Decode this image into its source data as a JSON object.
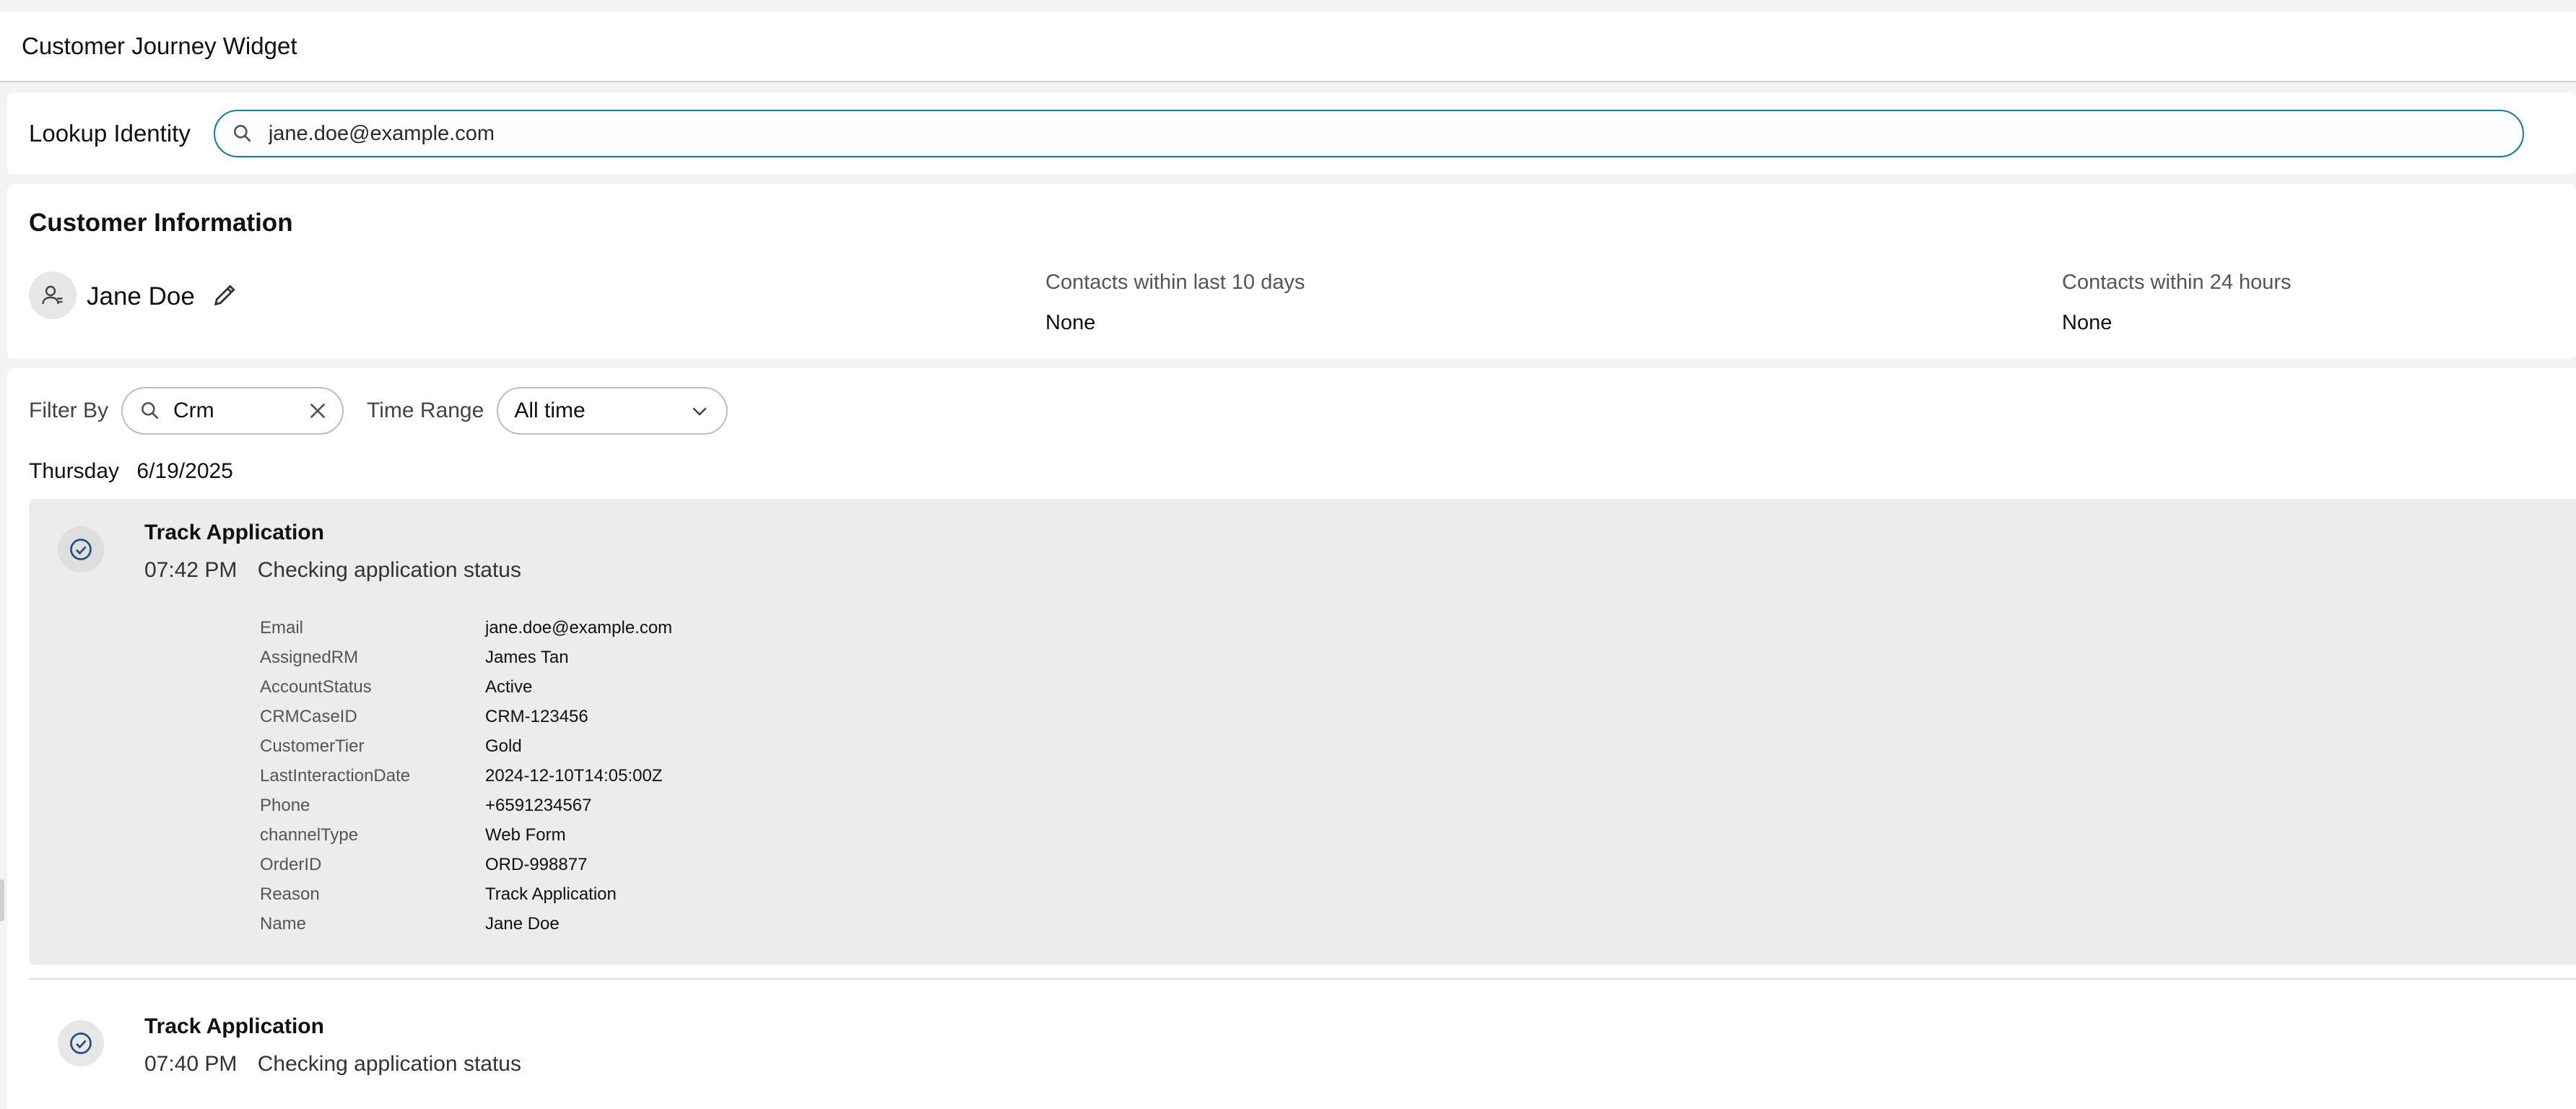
{
  "header": {
    "title": "Customer Journey Widget"
  },
  "lookup": {
    "label": "Lookup Identity",
    "search_value": "jane.doe@example.com"
  },
  "customer_info": {
    "title": "Customer Information",
    "name": "Jane Doe",
    "stats": [
      {
        "label": "Contacts within last 10 days",
        "value": "None"
      },
      {
        "label": "Contacts within 24 hours",
        "value": "None"
      }
    ]
  },
  "filters": {
    "filter_label": "Filter By",
    "filter_value": "Crm",
    "time_range_label": "Time Range",
    "time_range_value": "All time"
  },
  "journey": {
    "date_day": "Thursday",
    "date_value": "6/19/2025",
    "entries": [
      {
        "title": "Track Application",
        "time": "07:42 PM",
        "description": "Checking application status",
        "details": [
          {
            "key": "Email",
            "value": "jane.doe@example.com"
          },
          {
            "key": "AssignedRM",
            "value": "James Tan"
          },
          {
            "key": "AccountStatus",
            "value": "Active"
          },
          {
            "key": "CRMCaseID",
            "value": "CRM-123456"
          },
          {
            "key": "CustomerTier",
            "value": "Gold"
          },
          {
            "key": "LastInteractionDate",
            "value": "2024-12-10T14:05:00Z"
          },
          {
            "key": "Phone",
            "value": "+6591234567"
          },
          {
            "key": "channelType",
            "value": "Web Form"
          },
          {
            "key": "OrderID",
            "value": "ORD-998877"
          },
          {
            "key": "Reason",
            "value": "Track Application"
          },
          {
            "key": "Name",
            "value": "Jane Doe"
          }
        ]
      },
      {
        "title": "Track Application",
        "time": "07:40 PM",
        "description": "Checking application status"
      }
    ]
  },
  "icons": {
    "search": "search-icon",
    "avatar": "user-icon",
    "edit": "pencil-icon",
    "clear": "close-icon",
    "dropdown": "chevron-down-icon",
    "status": "check-circle-icon"
  },
  "colors": {
    "accent": "#0a7fa8",
    "expanded_bg": "#ececec",
    "icon_stroke": "#1f4f86"
  }
}
